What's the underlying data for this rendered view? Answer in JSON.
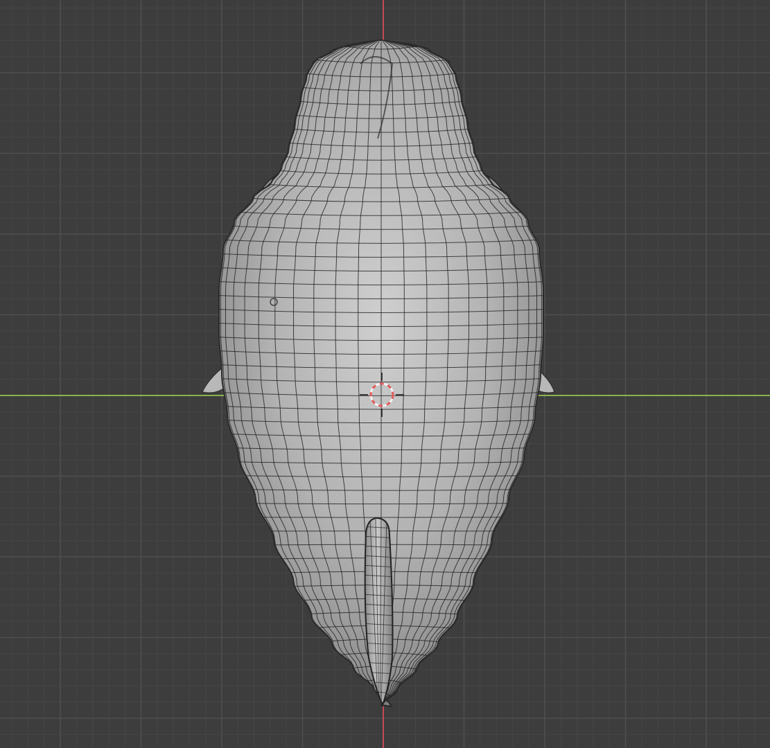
{
  "viewport": {
    "view": "top-orthographic",
    "grid_visible": true,
    "mesh_display": "wireframe-overlay",
    "object_shape": "bird-body"
  },
  "colors": {
    "background": "#3d3d3d",
    "grid_minor": "#464646",
    "grid_major": "#4f4f4f",
    "x_axis": "#8cb34d",
    "y_axis": "#c44a57",
    "mesh_fill": "#9a9a9a",
    "mesh_wire": "#1e1e1e",
    "cursor_ring_red": "#e05a5a",
    "cursor_ring_white": "#f2f2f2"
  },
  "icons": {
    "cursor": "3d-cursor-icon",
    "origin": "object-origin-icon"
  }
}
